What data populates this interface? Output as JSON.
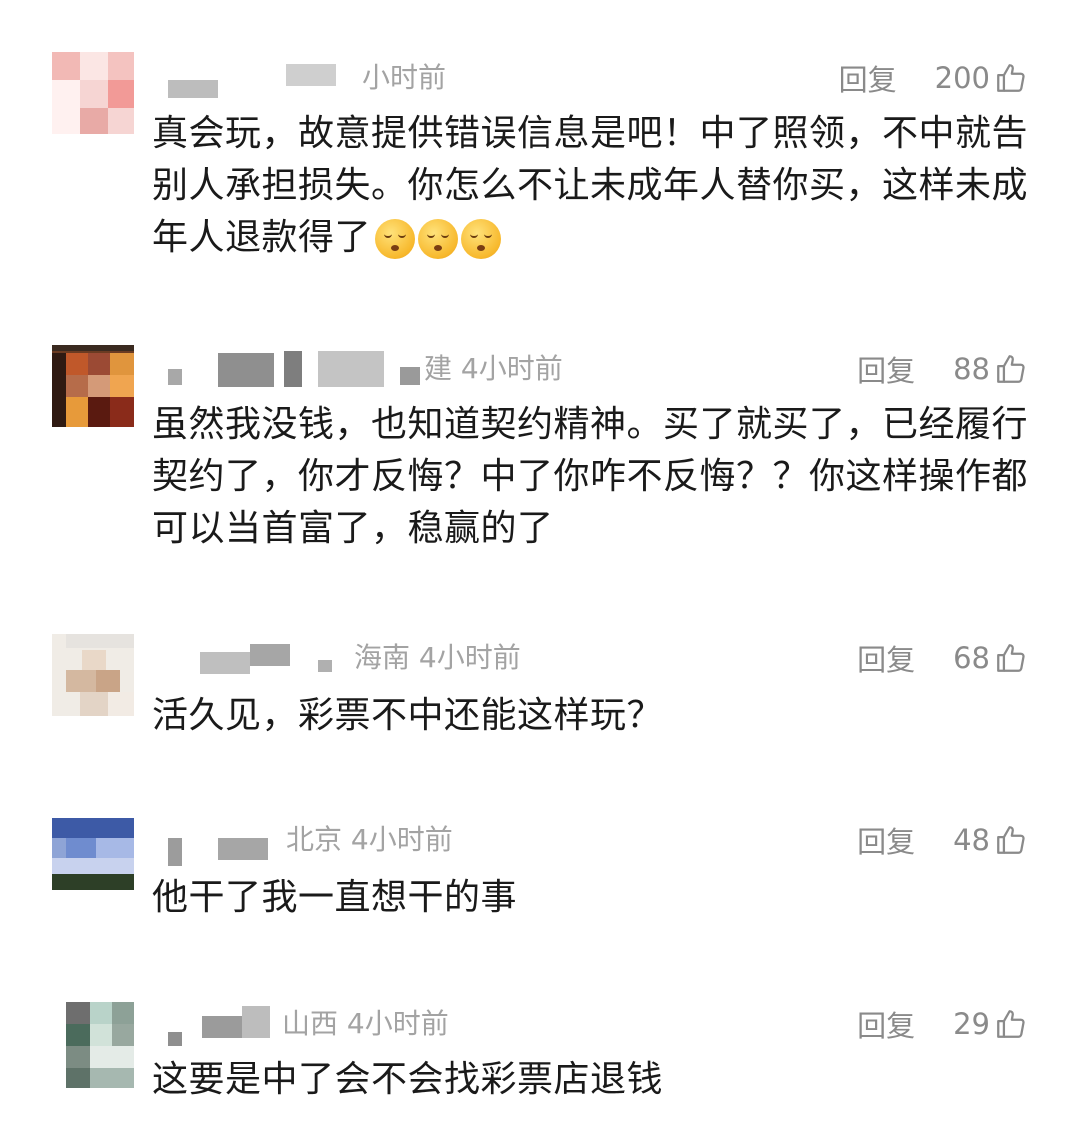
{
  "comments": [
    {
      "meta": "小时前",
      "reply_label": "回复",
      "likes": "200",
      "text": "真会玩，故意提供错误信息是吧！中了照领，不中就告别人承担损失。你怎么不让未成年人替你买，这样未成年人退款得了",
      "emoji": "hushed-face-emoji"
    },
    {
      "meta": "建 4小时前",
      "reply_label": "回复",
      "likes": "88",
      "text": "虽然我没钱，也知道契约精神。买了就买了，已经履行契约了，你才反悔？中了你咋不反悔？？你这样操作都可以当首富了，稳赢的了"
    },
    {
      "meta": "海南 4小时前",
      "reply_label": "回复",
      "likes": "68",
      "text": "活久见，彩票不中还能这样玩？"
    },
    {
      "meta": "北京 4小时前",
      "reply_label": "回复",
      "likes": "48",
      "text": "他干了我一直想干的事"
    },
    {
      "meta": "山西 4小时前",
      "reply_label": "回复",
      "likes": "29",
      "text": "这要是中了会不会找彩票店退钱"
    }
  ],
  "icons": {
    "like": "thumbs-up-icon",
    "avatar": "avatar"
  }
}
